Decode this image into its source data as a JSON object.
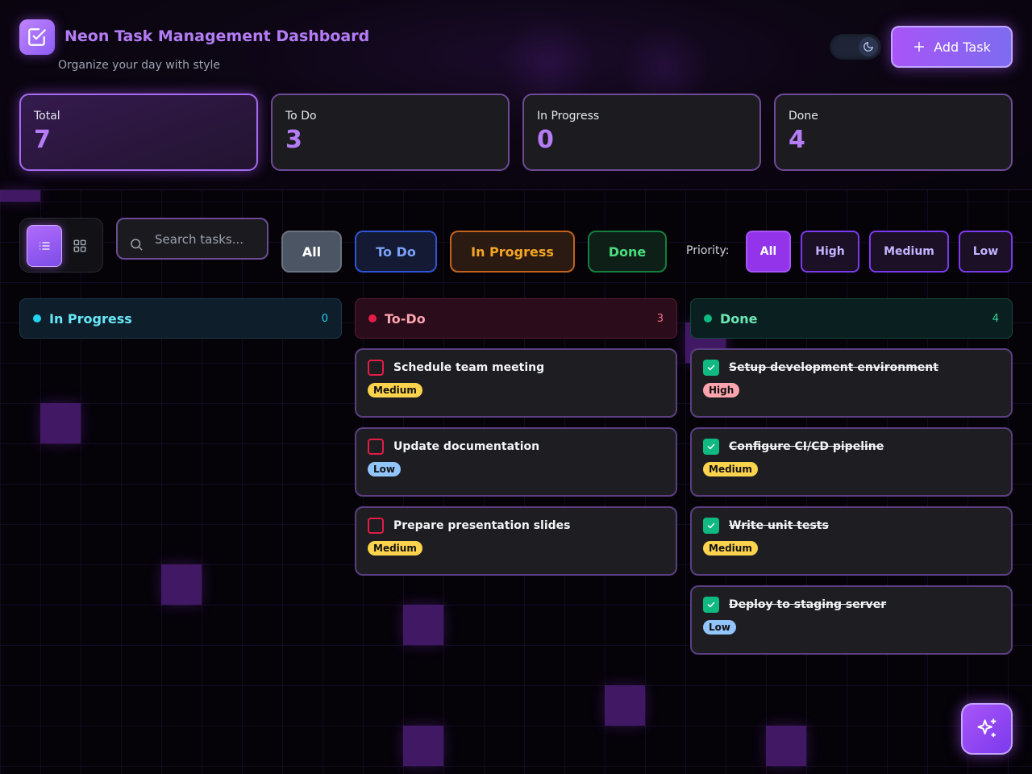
{
  "header": {
    "title": "Neon Task Management Dashboard",
    "subtitle": "Organize your day with style",
    "add_task_label": "Add Task"
  },
  "stats": [
    {
      "label": "Total",
      "value": "7"
    },
    {
      "label": "To Do",
      "value": "3"
    },
    {
      "label": "In Progress",
      "value": "0"
    },
    {
      "label": "Done",
      "value": "4"
    }
  ],
  "toolbar": {
    "search_placeholder": "Search tasks...",
    "status_filters": [
      "All",
      "To Do",
      "In Progress",
      "Done"
    ],
    "priority_label": "Priority:",
    "priority_filters": [
      "All",
      "High",
      "Medium",
      "Low"
    ]
  },
  "columns": {
    "in_progress": {
      "title": "In Progress",
      "count": "0"
    },
    "todo": {
      "title": "To-Do",
      "count": "3",
      "tasks": [
        {
          "title": "Schedule team meeting",
          "priority": "Medium"
        },
        {
          "title": "Update documentation",
          "priority": "Low"
        },
        {
          "title": "Prepare presentation slides",
          "priority": "Medium"
        }
      ]
    },
    "done": {
      "title": "Done",
      "count": "4",
      "tasks": [
        {
          "title": "Setup development environment",
          "priority": "High"
        },
        {
          "title": "Configure CI/CD pipeline",
          "priority": "Medium"
        },
        {
          "title": "Write unit tests",
          "priority": "Medium"
        },
        {
          "title": "Deploy to staging server",
          "priority": "Low"
        }
      ]
    }
  },
  "colors": {
    "accent": "#a855f7",
    "todo": "#e11d48",
    "in_progress": "#22d3ee",
    "done": "#10b981",
    "priority_high": "#fda4af",
    "priority_medium": "#fcd34d",
    "priority_low": "#93c5fd"
  },
  "icons": {
    "logo": "check-square-icon",
    "theme": "moon-icon",
    "add": "plus-icon",
    "list_view": "list-icon",
    "grid_view": "grid-icon",
    "search": "search-icon",
    "fab": "sparkles-icon"
  }
}
